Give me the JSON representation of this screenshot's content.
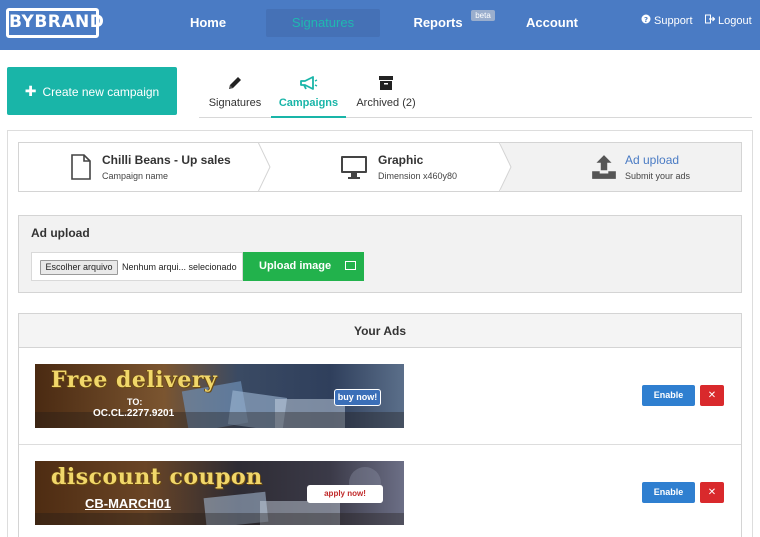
{
  "nav": {
    "logo": "BYBRAND",
    "items": [
      {
        "label": "Home"
      },
      {
        "label": "Signatures"
      },
      {
        "label": "Reports",
        "badge": "beta"
      },
      {
        "label": "Account"
      }
    ],
    "support": "Support",
    "logout": "Logout",
    "colors": {
      "bar": "#4a7bc4",
      "active_text": "#1fb8b0"
    }
  },
  "create_button": {
    "label": "Create new campaign",
    "color": "#19b5a8"
  },
  "tabs": [
    {
      "label": "Signatures",
      "icon": "pencil-icon"
    },
    {
      "label": "Campaigns",
      "icon": "megaphone-icon",
      "active": true
    },
    {
      "label": "Archived (2)",
      "icon": "archive-box-icon"
    }
  ],
  "steps": [
    {
      "title": "Chilli Beans - Up sales",
      "subtitle": "Campaign name",
      "icon": "document-icon"
    },
    {
      "title": "Graphic",
      "subtitle": "Dimension x460y80",
      "icon": "monitor-icon"
    },
    {
      "title": "Ad upload",
      "subtitle": "Submit your ads",
      "icon": "upload-icon",
      "active": true
    }
  ],
  "upload": {
    "title": "Ad upload",
    "file_button": "Escolher arquivo",
    "file_status": "Nenhum arqui... selecionado",
    "upload_button": "Upload image",
    "upload_color": "#22b24c"
  },
  "ads": {
    "header": "Your Ads",
    "items": [
      {
        "headline": "Free delivery",
        "line1": "TO:",
        "line2": "OC.CL.2277.9201",
        "cta": "buy now!",
        "enable": "Enable",
        "delete": "✕"
      },
      {
        "headline": "discount coupon",
        "line2": "CB-MARCH01",
        "cta": "apply now!",
        "enable": "Enable",
        "delete": "✕"
      }
    ],
    "colors": {
      "enable": "#2f7fd0",
      "delete": "#d9292c"
    }
  }
}
